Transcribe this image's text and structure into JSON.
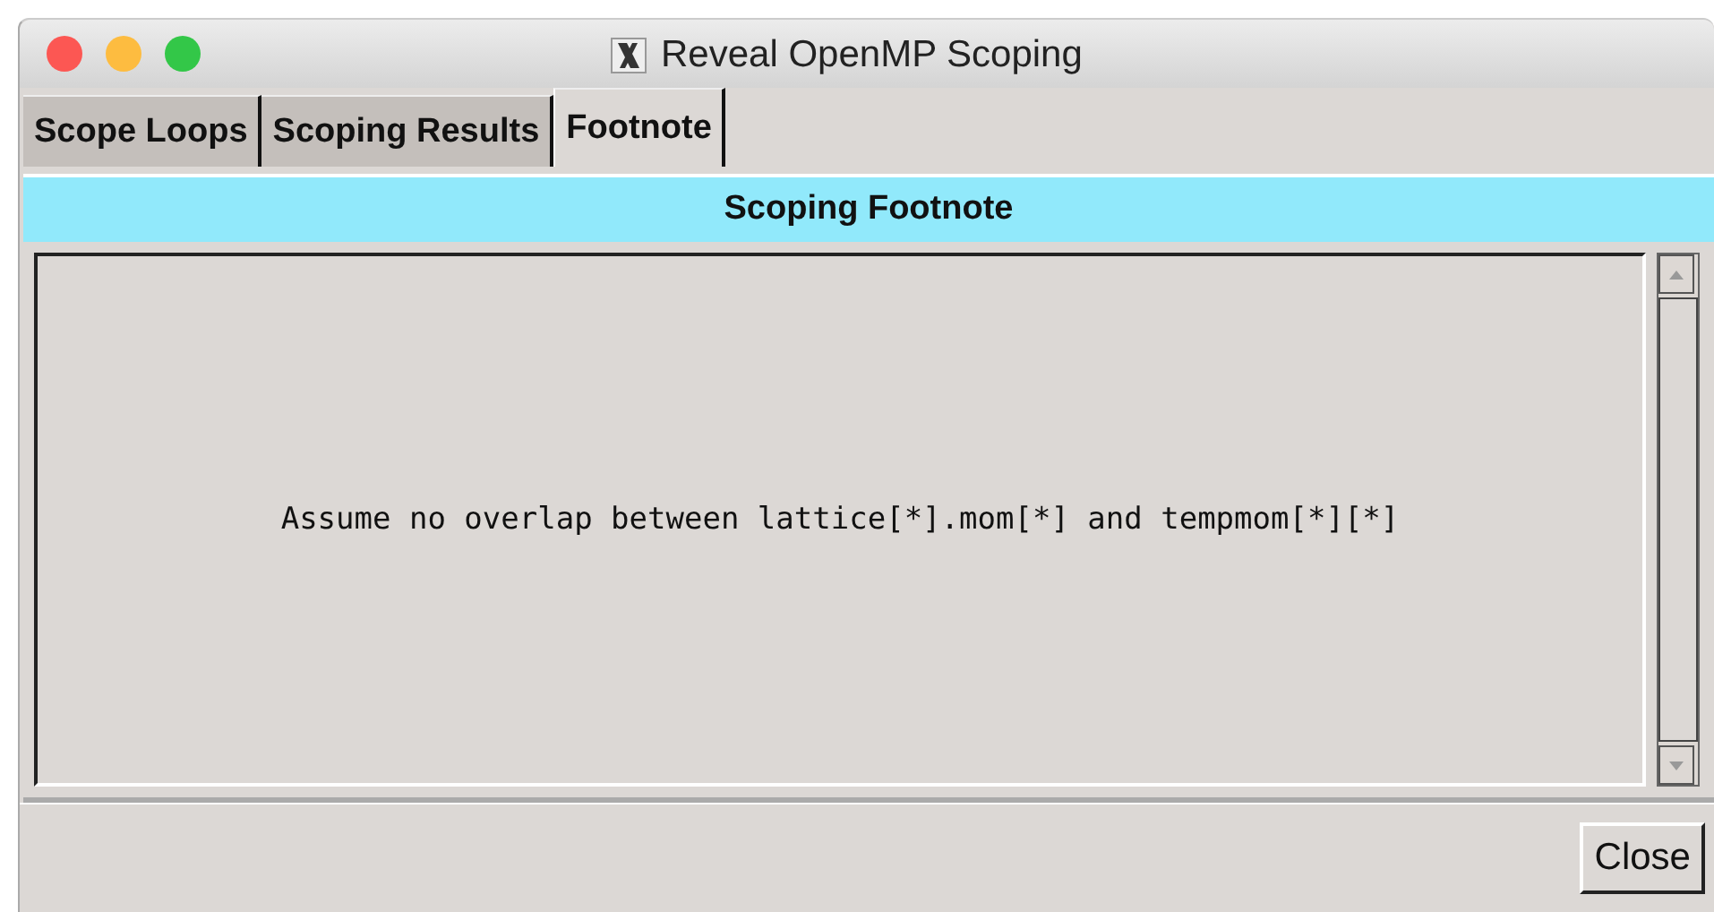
{
  "window": {
    "title": "Reveal OpenMP Scoping"
  },
  "tabs": [
    {
      "label": "Scope Loops",
      "selected": false
    },
    {
      "label": "Scoping Results",
      "selected": false
    },
    {
      "label": "Footnote",
      "selected": true
    }
  ],
  "panel": {
    "heading": "Scoping Footnote",
    "text": "Assume no overlap between lattice[*].mom[*] and tempmom[*][*]"
  },
  "buttons": [
    "Close"
  ]
}
